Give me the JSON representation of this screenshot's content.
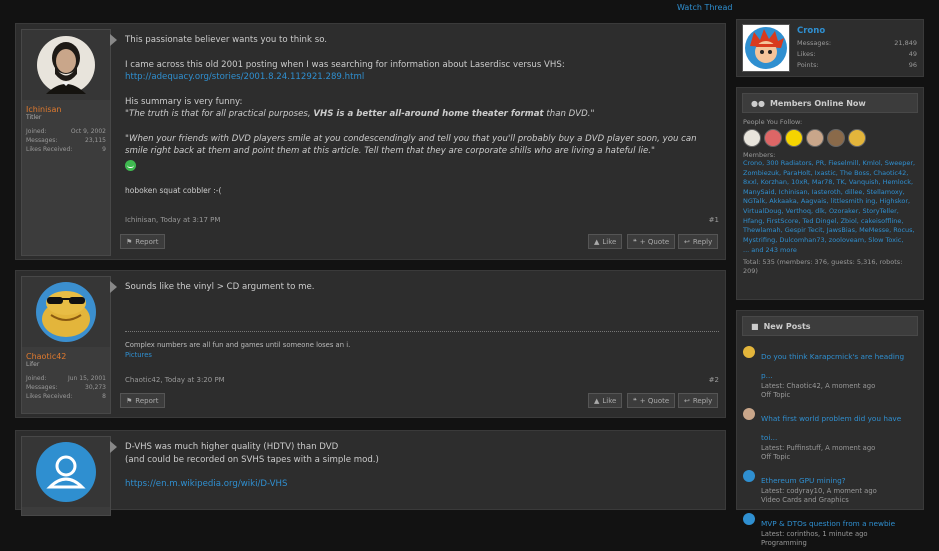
{
  "watch_thread": "Watch Thread",
  "posts": [
    {
      "username": "Ichinisan",
      "user_title": "Titler",
      "stats": [
        {
          "label": "Joined:",
          "value": "Oct 9, 2002"
        },
        {
          "label": "Messages:",
          "value": "23,115"
        },
        {
          "label": "Likes Received:",
          "value": "9"
        }
      ],
      "intro": "This passionate believer wants you to think so.",
      "p2": "I came across this old 2001 posting when I was searching for information about Laserdisc versus VHS:",
      "link": "http://adequacy.org/stories/2001.8.24.112921.289.html",
      "summary_label": "His summary is very funny:",
      "quote1_a": "\"The truth is that for all practical purposes, ",
      "quote1_b": "VHS is a better all-around home theater format",
      "quote1_c": " than DVD.\"",
      "quote2": "\"When your friends with DVD players smile at you condescendingly and tell you that you'll probably buy a DVD player soon, you can smile right back at them and point them at this article. Tell them that they are corporate shills who are living a hateful lie.\"",
      "closing": "hoboken squat cobbler :-(",
      "meta": "Ichinisan, Today at 3:17 PM",
      "num": "#1",
      "report": "Report",
      "like": "Like",
      "quote": "+ Quote",
      "reply": "Reply"
    },
    {
      "username": "Chaotic42",
      "user_title": "Lifer",
      "stats": [
        {
          "label": "Joined:",
          "value": "Jun 15, 2001"
        },
        {
          "label": "Messages:",
          "value": "30,273"
        },
        {
          "label": "Likes Received:",
          "value": "8"
        }
      ],
      "text": "Sounds like the vinyl > CD argument to me.",
      "sig": "Complex numbers are all fun and games until someone loses an i.",
      "sig_link": "Pictures",
      "meta": "Chaotic42, Today at 3:20 PM",
      "num": "#2",
      "report": "Report",
      "like": "Like",
      "quote": "+ Quote",
      "reply": "Reply"
    },
    {
      "line1": "D-VHS was much higher quality (HDTV) than DVD",
      "line2": "(and could be recorded on SVHS tapes with a simple mod.)",
      "link": "https://en.m.wikipedia.org/wiki/D-VHS"
    }
  ],
  "profile": {
    "name": "Crono",
    "stats": [
      {
        "label": "Messages:",
        "value": "21,849"
      },
      {
        "label": "Likes:",
        "value": "49"
      },
      {
        "label": "Points:",
        "value": "96"
      }
    ]
  },
  "members_online": {
    "title": "Members Online Now",
    "follow_label": "People You Follow:",
    "members_label": "Members:",
    "members_text": "Crono, 300 Radiators, PR, Fieselmill, Kmlol, Sweeper, Zombiezuk, ParaHolt, Ixastic, The Boss, Chaotic42, 8xxl, Korzhan, 10xR, Mar78, TK, Vanquish, Hemlock, ManySaid, Ichinisan, Iasteroth, dillee, Stellamoxy, NGTalk, Akkaaka, Aagvais, littlesmith ing, Highskor, VirtualDoug, Verthoq, dlk, Ozoraker, StoryTeller, Hfang, FirstScore, Ted Dingel, Zbiol, cakeisoffline, Thewlamah, Gespir Tecit, JawsBias, MeMesse, Rocus, Mystrifing, Dulcomhan73, zooloveam, Slow Toxic, Tooo999, Trusken, koorktang...",
    "more": "... and 243 more",
    "total": "Total: 535 (members: 376, guests: 5,316, robots: 209)"
  },
  "new_posts": {
    "title": "New Posts",
    "items": [
      {
        "title": "Do you think Karapcmick's are heading p...",
        "by": "Latest: Chaotic42, A moment ago",
        "forum": "Off Topic"
      },
      {
        "title": "What first world problem did you have toi...",
        "by": "Latest: Puffinstuff, A moment ago",
        "forum": "Off Topic"
      },
      {
        "title": "Ethereum GPU mining?",
        "by": "Latest: codyray10, A moment ago",
        "forum": "Video Cards and Graphics"
      },
      {
        "title": "MVP & DTOs question from a newbie",
        "by": "Latest: corinthos, 1 minute ago",
        "forum": "Programming"
      }
    ]
  },
  "colors": {
    "link": "#2f8fd0",
    "username": "#e07a2e",
    "panel": "#2d2d2d"
  }
}
